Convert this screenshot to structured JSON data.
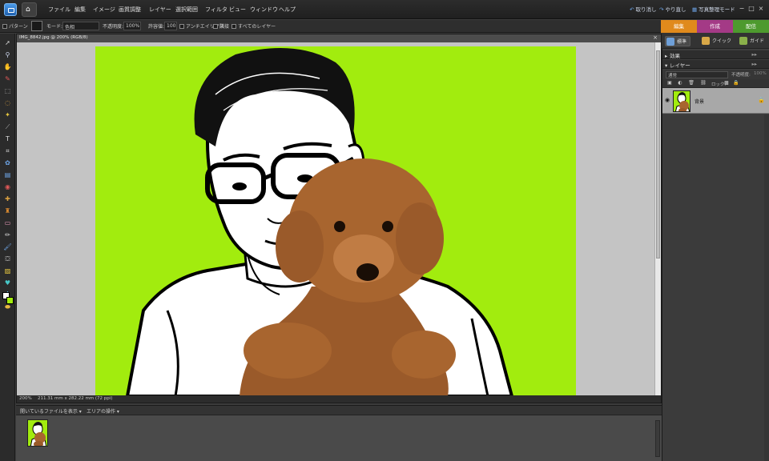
{
  "menubar": {
    "items": [
      "ファイル",
      "編集",
      "イメージ",
      "画質調整",
      "レイヤー",
      "選択範囲",
      "フィルタ",
      "ビュー",
      "ウィンドウ",
      "ヘルプ"
    ],
    "undo_label": "取り消し",
    "redo_label": "やり直し",
    "organizer_label": "写真整理モード"
  },
  "options": {
    "pattern_label": "パターン",
    "mode_label": "モード:",
    "mode_value": "色相",
    "opacity_label": "不透明度:",
    "opacity_value": "100%",
    "tolerance_label": "許容値:",
    "tolerance_value": "100",
    "antialias_label": "アンチエイリアス",
    "contiguous_label": "隣接",
    "all_layers_label": "すべてのレイヤー"
  },
  "mode_tabs": [
    {
      "label": "編集",
      "color": "#e08a1c"
    },
    {
      "label": "作成",
      "color": "#a43a86"
    },
    {
      "label": "配信",
      "color": "#4d9a2e"
    }
  ],
  "edit_subtabs": {
    "standard": "標準",
    "quick": "クイック",
    "guide": "ガイド"
  },
  "document": {
    "title": "IMG_8842.jpg @ 200% (RGB/8)",
    "zoom": "200%",
    "dimensions": "211.31 mm x 282.22 mm (72 ppi)"
  },
  "bin": {
    "show_files_label": "開いているファイルを表示",
    "actions_label": "エリアの操作"
  },
  "panels": {
    "effects_title": "効果",
    "layers_title": "レイヤー",
    "blend_mode": "通常",
    "opacity_label": "不透明度:",
    "opacity_value": "100%",
    "lock_label": "ロック:",
    "layer_name": "背景"
  },
  "colors": {
    "image_background": "#a2ec0e",
    "accent_blue": "#6fa7ea"
  },
  "icons": [
    "home-icon",
    "undo-icon",
    "redo-icon",
    "eye-icon",
    "lock-icon"
  ]
}
